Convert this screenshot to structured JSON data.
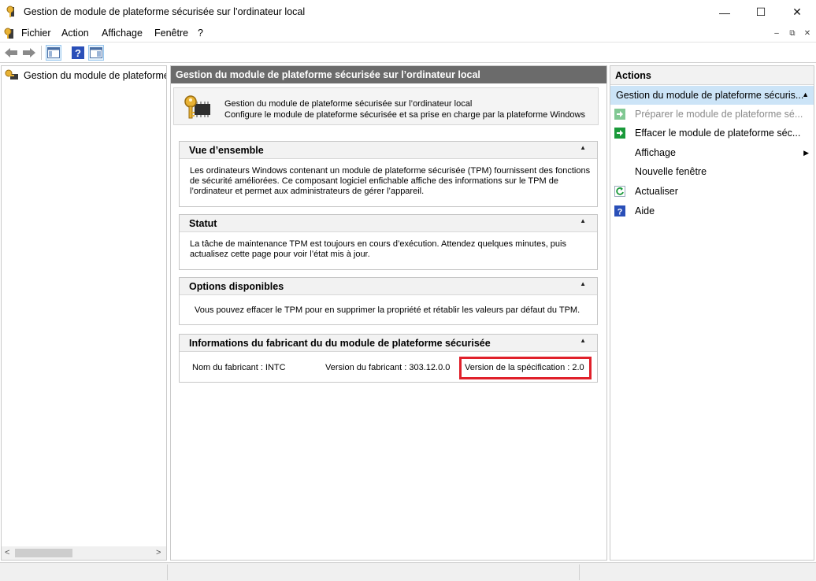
{
  "window": {
    "title": "Gestion de module de plateforme sécurisée sur l’ordinateur local",
    "minimize": "—",
    "maximize": "☐",
    "close": "✕"
  },
  "menu": {
    "items": [
      "Fichier",
      "Action",
      "Affichage",
      "Fenêtre",
      "?"
    ],
    "mdi_min": "–",
    "mdi_restore": "⧉",
    "mdi_close": "✕"
  },
  "toolbar": {
    "icons": [
      "back-arrow-icon",
      "forward-arrow-icon",
      "show-tree-icon",
      "help-icon",
      "show-action-pane-icon"
    ]
  },
  "tree": {
    "root_label": "Gestion du module de plateforme s",
    "scroll_left": "<",
    "scroll_right": ">"
  },
  "center": {
    "header": "Gestion du module de plateforme sécurisée sur l’ordinateur local",
    "intro_line1": "Gestion du module de plateforme sécurisée sur l’ordinateur local",
    "intro_line2": "Configure le module de plateforme sécurisée et sa prise en charge par la plateforme Windows",
    "sections": {
      "overview": {
        "title": "Vue d’ensemble",
        "lines": [
          "Les ordinateurs Windows contenant un module de plateforme sécurisée (TPM) fournissent des fonctions",
          "de sécurité améliorées. Ce composant logiciel enfichable affiche des informations sur le TPM de",
          "l’ordinateur et permet aux administrateurs de gérer l’appareil."
        ]
      },
      "statut": {
        "title": "Statut",
        "lines": [
          "La tâche de maintenance TPM est toujours en cours d’exécution. Attendez quelques minutes, puis",
          "actualisez cette page pour voir l’état mis à jour."
        ]
      },
      "options": {
        "title": "Options disponibles",
        "lines": [
          "Vous pouvez effacer le TPM pour en supprimer la propriété et rétablir les valeurs par défaut du TPM."
        ]
      },
      "info": {
        "title": "Informations du fabricant du du module de plateforme sécurisée",
        "manufacturer_name": "Nom du fabricant :  INTC",
        "manufacturer_version": "Version du fabricant :  303.12.0.0",
        "spec_version": "Version de la spécification :  2.0"
      }
    },
    "collapse_glyph": "▲"
  },
  "actions": {
    "header": "Actions",
    "group": "Gestion du module de plateforme sécuris...",
    "group_glyph": "▲",
    "items": [
      {
        "label": "Préparer le module de plateforme sé...",
        "icon": "green-arrow-icon",
        "enabled": false
      },
      {
        "label": "Effacer le module de plateforme séc...",
        "icon": "green-arrow-icon",
        "enabled": true
      },
      {
        "label": "Affichage",
        "icon": "",
        "enabled": true
      },
      {
        "label": "Nouvelle fenêtre",
        "icon": "",
        "enabled": true
      },
      {
        "label": "Actualiser",
        "icon": "refresh-icon",
        "enabled": true
      },
      {
        "label": "Aide",
        "icon": "help-icon",
        "enabled": true
      }
    ],
    "submenu_glyph": "▶"
  },
  "colors": {
    "highlight_border": "#e0202a",
    "header_bg": "#6b6b6b",
    "selection_bg": "#cce4f7",
    "action_green": "#1a9a3a",
    "help_blue": "#2a4fb8"
  }
}
